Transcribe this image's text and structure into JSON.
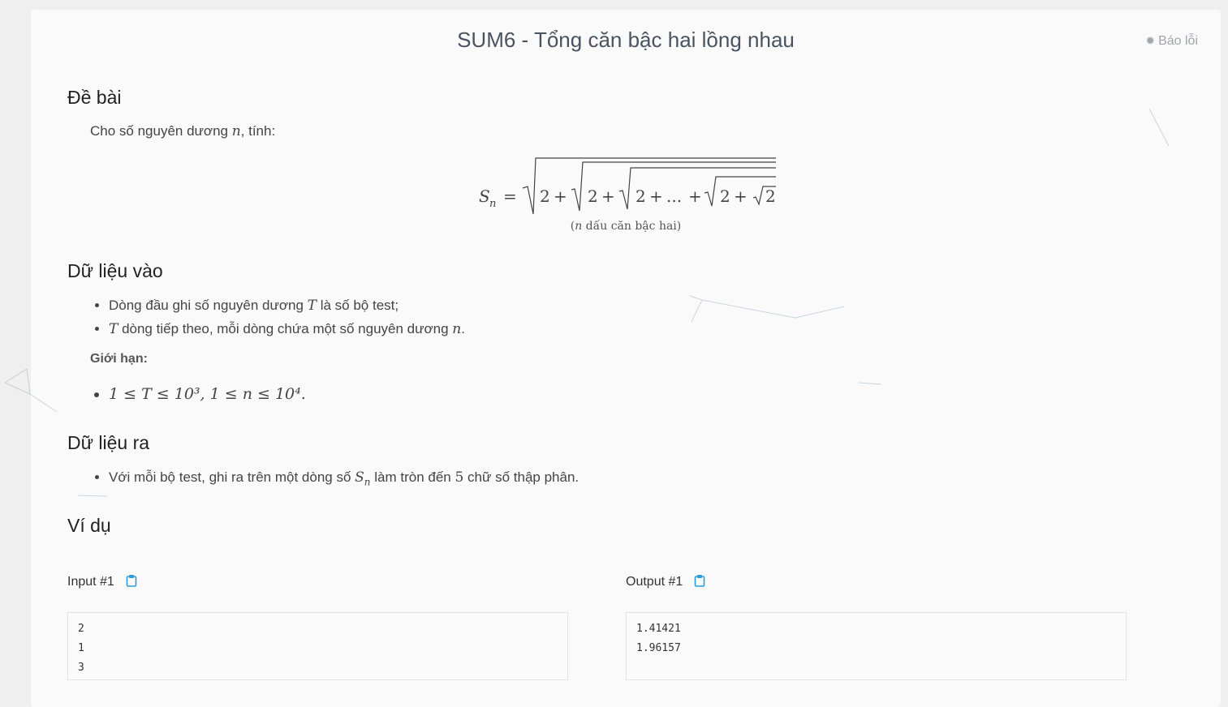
{
  "problem": {
    "title": "SUM6 - Tổng căn bậc hai lồng nhau",
    "report_label": "Báo lỗi"
  },
  "sections": {
    "statement": {
      "heading": "Đề bài",
      "intro_before": "Cho số nguyên dương ",
      "intro_var": "n",
      "intro_after": ", tính:",
      "formula_lhs": "S",
      "formula_sub": "n",
      "formula_caption_var": "n",
      "formula_caption_text": " dấu căn bậc hai",
      "formula_terms": [
        "2",
        "+",
        "2",
        "+",
        "2",
        "+",
        "...",
        "+",
        "2",
        "+",
        "2"
      ]
    },
    "input": {
      "heading": "Dữ liệu vào",
      "items": [
        {
          "before": "Dòng đầu ghi số nguyên dương ",
          "var": "T",
          "after": " là số bộ test;"
        },
        {
          "before": "",
          "var": "T",
          "after": " dòng tiếp theo, mỗi dòng chứa một số nguyên dương ",
          "var2": "n",
          "after2": "."
        }
      ],
      "limits_label": "Giới hạn:",
      "limit_text": "1 ≤ T ≤ 10³, 1 ≤ n ≤ 10⁴."
    },
    "output": {
      "heading": "Dữ liệu ra",
      "item_before": "Với mỗi bộ test, ghi ra trên một dòng số ",
      "item_var": "S",
      "item_sub": "n",
      "item_mid": " làm tròn đến ",
      "item_num": "5",
      "item_after": " chữ số thập phân."
    },
    "example": {
      "heading": "Ví dụ",
      "input_label": "Input #1",
      "output_label": "Output #1",
      "input_lines": [
        "2",
        "1",
        "3"
      ],
      "output_lines": [
        "1.41421",
        "1.96157"
      ]
    }
  },
  "colors": {
    "accent": "#2d9cdb",
    "title": "#4a5360"
  },
  "icons": {
    "report": "bug-icon",
    "copy": "clipboard-icon"
  }
}
